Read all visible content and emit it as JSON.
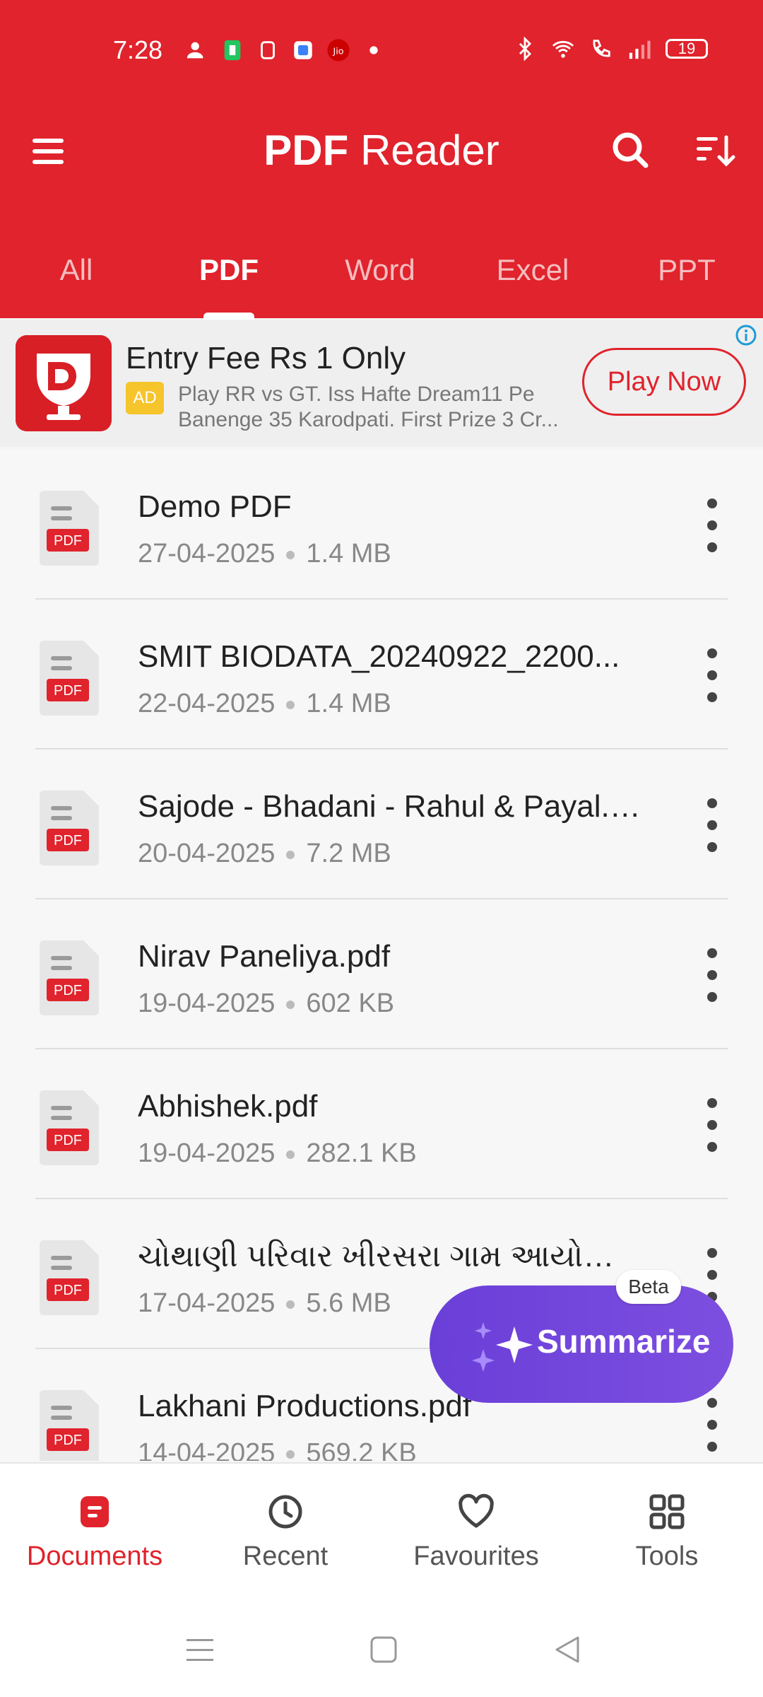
{
  "status_bar": {
    "time": "7:28",
    "battery": "19"
  },
  "app_bar": {
    "title_part1": "PDF",
    "title_part2": "Reader"
  },
  "tabs": [
    "All",
    "PDF",
    "Word",
    "Excel",
    "PPT"
  ],
  "active_tab": "PDF",
  "ad": {
    "title": "Entry Fee Rs 1 Only",
    "badge": "AD",
    "text": "Play RR vs GT. Iss Hafte Dream11 Pe Banenge 35 Karodpati. First Prize 3 Cr...",
    "cta": "Play Now"
  },
  "files": [
    {
      "name": "Demo PDF",
      "date": "27-04-2025",
      "size": "1.4 MB",
      "type": "PDF"
    },
    {
      "name": "SMIT BIODATA_20240922_2200...",
      "date": "22-04-2025",
      "size": "1.4 MB",
      "type": "PDF"
    },
    {
      "name": "Sajode - Bhadani - Rahul & Payal.…",
      "date": "20-04-2025",
      "size": "7.2 MB",
      "type": "PDF"
    },
    {
      "name": "Nirav Paneliya.pdf",
      "date": "19-04-2025",
      "size": "602 KB",
      "type": "PDF"
    },
    {
      "name": "Abhishek.pdf",
      "date": "19-04-2025",
      "size": "282.1 KB",
      "type": "PDF"
    },
    {
      "name": "ચોથાણી પરિવાર ખીરસરા ગામ આયોજિત ...",
      "date": "17-04-2025",
      "size": "5.6 MB",
      "type": "PDF"
    },
    {
      "name": "Lakhani Productions.pdf",
      "date": "14-04-2025",
      "size": "569.2 KB",
      "type": "PDF"
    }
  ],
  "fab": {
    "label": "Summarize",
    "badge": "Beta"
  },
  "bottom_nav": [
    {
      "label": "Documents",
      "icon": "document-icon"
    },
    {
      "label": "Recent",
      "icon": "clock-icon"
    },
    {
      "label": "Favourites",
      "icon": "heart-icon"
    },
    {
      "label": "Tools",
      "icon": "grid-icon"
    }
  ],
  "colors": {
    "brand": "#e0232c",
    "fab": "#6a3fd8"
  }
}
